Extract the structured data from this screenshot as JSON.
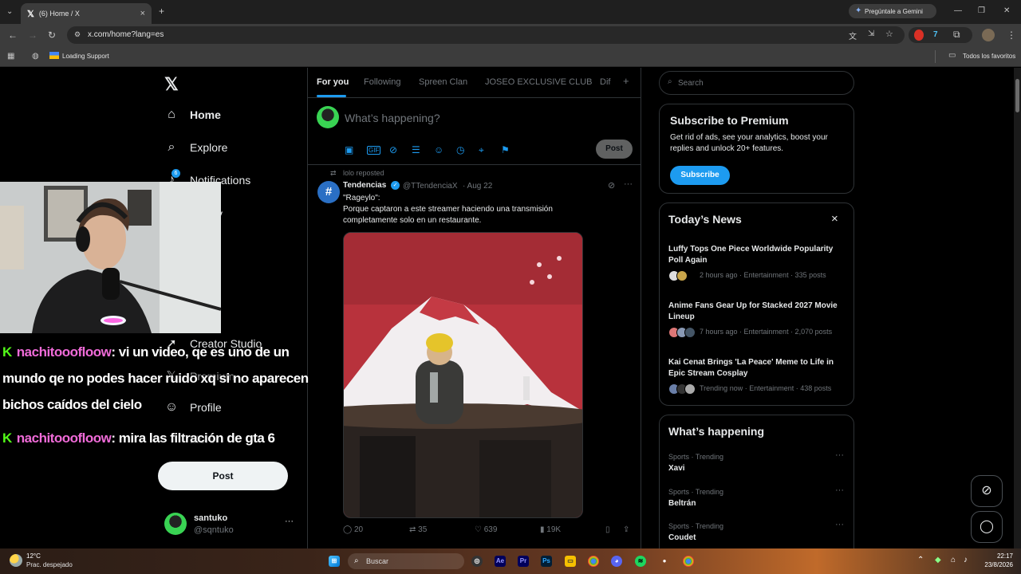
{
  "browser": {
    "tab_title": "(6) Home / X",
    "tab_close": "×",
    "new_tab": "+",
    "url": "x.com/home?lang=es",
    "gemini_button": "Pregúntale a Gemini",
    "bookmark_loading": "Loading Support",
    "bookmark_all": "Todos los favoritos",
    "window_min": "—",
    "window_max": "❐",
    "window_close": "✕"
  },
  "nav": {
    "items": [
      {
        "label": "Home",
        "icon": "home-icon"
      },
      {
        "label": "Explore",
        "icon": "search-icon"
      },
      {
        "label": "Notifications",
        "icon": "bell-icon",
        "badge": "6"
      },
      {
        "label": "Creator Studio",
        "icon": "rocket-icon"
      },
      {
        "label": "Premium",
        "icon": "x-icon"
      },
      {
        "label": "Profile",
        "icon": "person-icon"
      }
    ],
    "partial_labels": [
      "y",
      "ty",
      "More"
    ],
    "post_button": "Post",
    "account_name": "santuko",
    "account_handle": "@sqntuko",
    "account_more": "···"
  },
  "feed": {
    "tabs": [
      "For you",
      "Following",
      "Spreen Clan",
      "JOSEO EXCLUSIVE CLUB",
      "Dif"
    ],
    "tab_add": "+",
    "composer_placeholder": "What’s happening?",
    "composer_post": "Post",
    "tweet": {
      "repost_by": "lolo reposted",
      "author": "Tendencias",
      "handle": "@TTendenciaX",
      "date": "· Aug 22",
      "text_line1": "\"Rageylo\":",
      "text_line2": "Porque captaron a este streamer haciendo una transmisión completamente solo en un restaurante.",
      "replies": "20",
      "reposts": "35",
      "likes": "639",
      "views": "19K",
      "more": "···"
    }
  },
  "sidebar": {
    "search_placeholder": "Search",
    "premium": {
      "title": "Subscribe to Premium",
      "text": "Get rid of ads, see your analytics, boost your replies and unlock 20+ features.",
      "button": "Subscribe"
    },
    "news": {
      "title": "Today’s News",
      "close": "×",
      "items": [
        {
          "title": "Luffy Tops One Piece Worldwide Popularity Poll Again",
          "meta": "2 hours ago · Entertainment · 335 posts"
        },
        {
          "title": "Anime Fans Gear Up for Stacked 2027 Movie Lineup",
          "meta": "7 hours ago · Entertainment · 2,070 posts"
        },
        {
          "title": "Kai Cenat Brings 'La Peace' Meme to Life in Epic Stream Cosplay",
          "meta": "Trending now · Entertainment · 438 posts"
        }
      ]
    },
    "trends": {
      "title": "What’s happening",
      "items": [
        {
          "category": "Sports · Trending",
          "name": "Xavi"
        },
        {
          "category": "Sports · Trending",
          "name": "Beltrán"
        },
        {
          "category": "Sports · Trending",
          "name": "Coudet"
        }
      ],
      "more": "···"
    }
  },
  "overlay": {
    "chat": [
      {
        "user": "nachitooofloow",
        "message": ": vi un video, qe es uno de un"
      },
      {
        "user": "",
        "message": "mundo qe no podes hacer ruido xq si no aparecen"
      },
      {
        "user": "",
        "message": "bichos caídos del cielo"
      },
      {
        "user": "nachitooofloow",
        "message": ": mira las filtración de gta 6"
      }
    ],
    "chat_badge": "K"
  },
  "taskbar": {
    "weather_temp": "12°C",
    "weather_desc": "Prac. despejado",
    "search": "Buscar",
    "time": "22:17",
    "date": "23/8/2026"
  },
  "colors": {
    "accent": "#1d9bf0",
    "kick_green": "#53fc18",
    "chat_user": "#f06bd8"
  }
}
